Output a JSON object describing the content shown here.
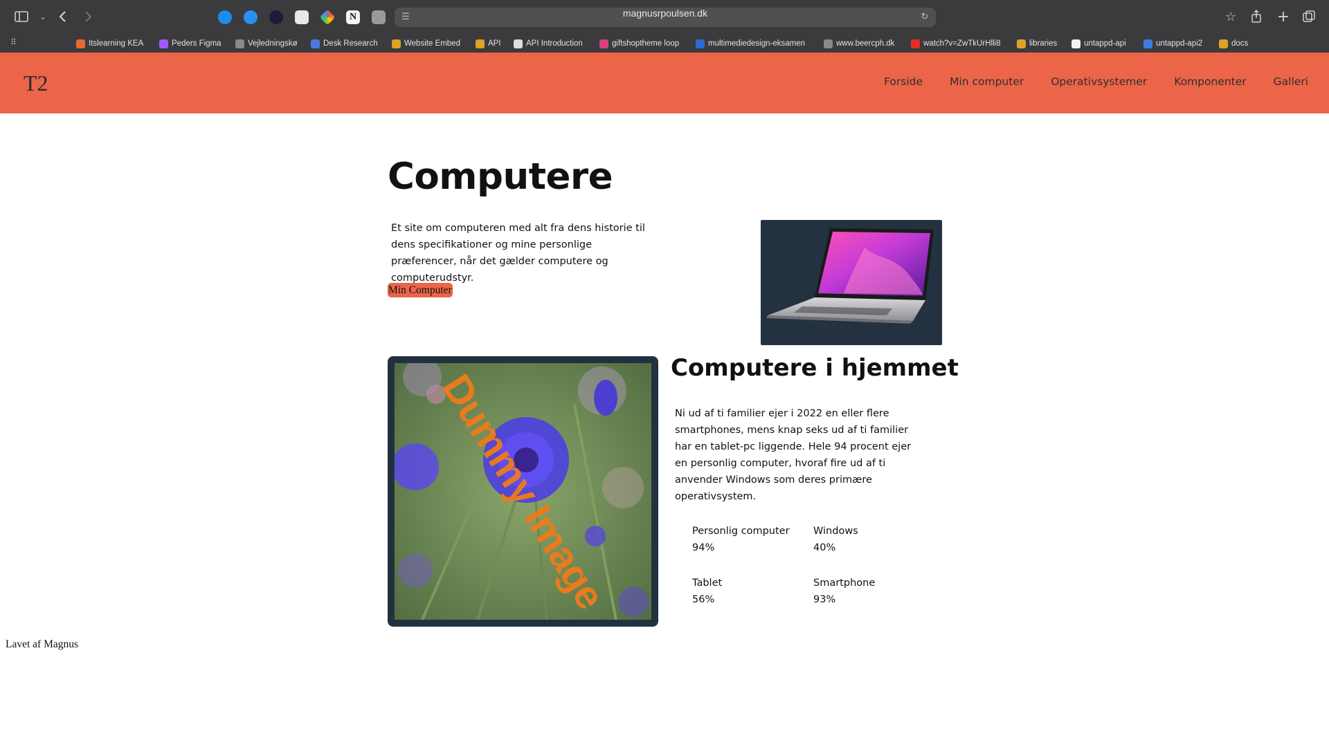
{
  "browser": {
    "url": "magnusrpoulsen.dk",
    "bookmarks": [
      {
        "label": "Itslearning KEA",
        "color": "#e8692d"
      },
      {
        "label": "Peders Figma",
        "color": "#a259ff"
      },
      {
        "label": "Vejledningskø",
        "color": "#8a8a8a"
      },
      {
        "label": "Desk Research",
        "color": "#4a7bdc"
      },
      {
        "label": "Website Embed",
        "color": "#e0a125"
      },
      {
        "label": "API",
        "color": "#e0a125"
      },
      {
        "label": "API Introduction",
        "color": "#dddddd"
      },
      {
        "label": "giftshoptheme loop",
        "color": "#d6407f"
      },
      {
        "label": "multimediedesign-eksamen",
        "color": "#2f6bd6"
      },
      {
        "label": "www.beercph.dk",
        "color": "#8a8a8a"
      },
      {
        "label": "watch?v=ZwTkUrHlli8",
        "color": "#e52d27"
      },
      {
        "label": "libraries",
        "color": "#e0a125"
      },
      {
        "label": "untappd-api",
        "color": "#f2f2f2"
      },
      {
        "label": "untappd-api2",
        "color": "#3f7be0"
      },
      {
        "label": "docs",
        "color": "#e0a125"
      }
    ]
  },
  "site": {
    "logo": "T2",
    "nav": [
      "Forside",
      "Min computer",
      "Operativsystemer",
      "Komponenter",
      "Galleri"
    ],
    "brand_color": "#ec6549"
  },
  "hero": {
    "title": "Computere",
    "text": "Et site om computeren med alt fra dens historie til dens specifikationer og mine personlige præferencer, når det gælder computere og computerudstyr.",
    "button": "Min Computer"
  },
  "section": {
    "image_text": "Dummy Image",
    "title": "Computere i hjemmet",
    "text": "Ni ud af ti familier ejer i 2022 en eller flere smartphones, mens knap seks ud af ti familier har en tablet-pc liggende. Hele 94 procent ejer en personlig computer, hvoraf fire ud af ti anvender Windows som deres primære operativsystem.",
    "stats": [
      {
        "label": "Personlig computer",
        "value": "94%"
      },
      {
        "label": "Windows",
        "value": "40%"
      },
      {
        "label": "Tablet",
        "value": "56%"
      },
      {
        "label": "Smartphone",
        "value": "93%"
      }
    ]
  },
  "footer": "Lavet af Magnus"
}
